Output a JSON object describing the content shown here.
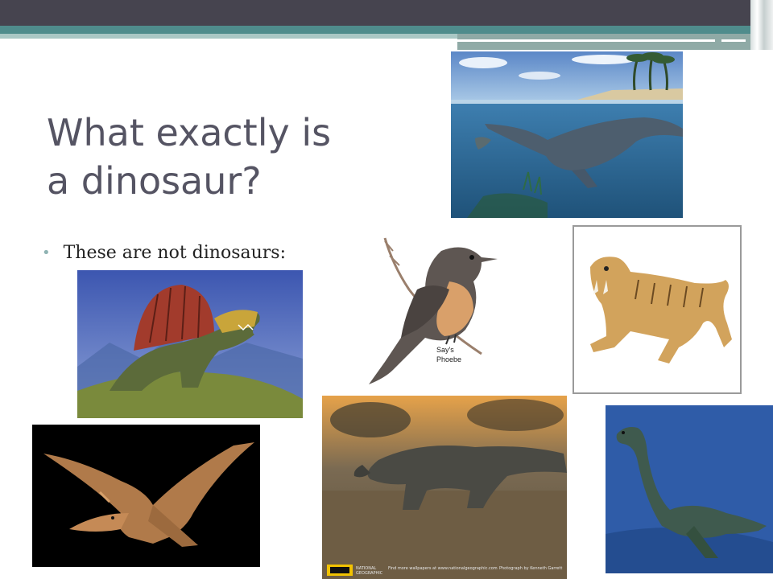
{
  "slide": {
    "title_line1": "What exactly is",
    "title_line2": "a dinosaur?",
    "bullet": "These are not dinosaurs:"
  },
  "images": {
    "bird_caption_line1": "Say's",
    "bird_caption_line2": "Phoebe",
    "komodo_logo_line1": "NATIONAL",
    "komodo_logo_line2": "GEOGRAPHIC",
    "komodo_credit_left": "Find more wallpapers at www.nationalgeographic.com",
    "komodo_credit_right": "Photograph by Kenneth Garrett"
  },
  "colors": {
    "title": "#555463",
    "bullet_dot": "#8fb3b3",
    "top_bar": "#46444f",
    "teal_band": "#4f8c8c"
  }
}
